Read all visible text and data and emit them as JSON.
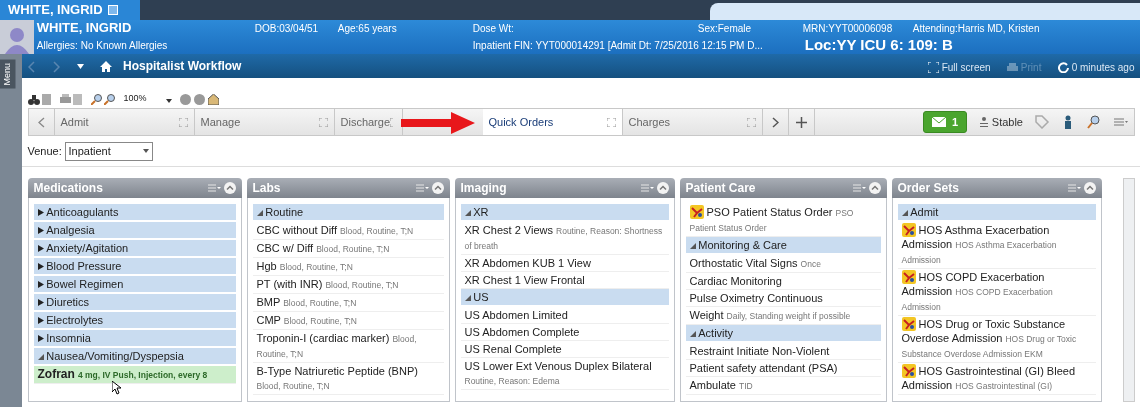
{
  "patient_tab": {
    "label": "WHITE, INGRID"
  },
  "banner": {
    "name": "WHITE, INGRID",
    "allergies": "Allergies: No Known Allergies",
    "row1": [
      "DOB:03/04/51",
      "Age:65 years",
      "Dose Wt:",
      "Sex:Female",
      "MRN:YYT00006098",
      "Attending:Harris MD, Kristen"
    ],
    "fin": "Inpatient FIN: YYT000014291 [Admit Dt: 7/25/2016 12:15 PM D...",
    "location": "Loc:YY ICU 6: 109: B"
  },
  "side_menu": {
    "label": "Menu"
  },
  "nav": {
    "title": "Hospitalist Workflow",
    "full_screen": "Full screen",
    "print": "Print",
    "refresh": "0 minutes ago"
  },
  "toolbar": {
    "zoom": "100%"
  },
  "tabs": [
    {
      "label": "Admit",
      "selected": false
    },
    {
      "label": "Manage",
      "selected": false
    },
    {
      "label": "Discharge",
      "selected": false
    },
    {
      "label": "Quick Orders",
      "selected": true
    },
    {
      "label": "Charges",
      "selected": false
    }
  ],
  "messages": {
    "count": "1"
  },
  "status": {
    "label": "Stable"
  },
  "venue": {
    "label": "Venue:",
    "value": "Inpatient"
  },
  "panels": [
    {
      "title": "Medications",
      "items": [
        {
          "kind": "group",
          "label": "Anticoagulants",
          "expanded": false
        },
        {
          "kind": "group",
          "label": "Analgesia",
          "expanded": false
        },
        {
          "kind": "group",
          "label": "Anxiety/Agitation",
          "expanded": false
        },
        {
          "kind": "group",
          "label": "Blood Pressure",
          "expanded": false
        },
        {
          "kind": "group",
          "label": "Bowel Regimen",
          "expanded": false
        },
        {
          "kind": "group",
          "label": "Diuretics",
          "expanded": false
        },
        {
          "kind": "group",
          "label": "Electrolytes",
          "expanded": false
        },
        {
          "kind": "group",
          "label": "Insomnia",
          "expanded": false
        },
        {
          "kind": "group",
          "label": "Nausea/Vomiting/Dyspepsia",
          "expanded": true
        },
        {
          "kind": "order",
          "label": "Zofran",
          "detail": "4 mg, IV Push, Injection, every 8",
          "selected": true
        }
      ]
    },
    {
      "title": "Labs",
      "items": [
        {
          "kind": "group",
          "label": "Routine",
          "expanded": true
        },
        {
          "kind": "order",
          "label": "CBC without Diff",
          "detail": "Blood, Routine, T;N",
          "selected": false
        },
        {
          "kind": "order",
          "label": "CBC w/ Diff",
          "detail": "Blood, Routine, T;N",
          "selected": false
        },
        {
          "kind": "order",
          "label": "Hgb",
          "detail": "Blood, Routine, T;N",
          "selected": false
        },
        {
          "kind": "order",
          "label": "PT (with INR)",
          "detail": "Blood, Routine, T;N",
          "selected": false
        },
        {
          "kind": "order",
          "label": "BMP",
          "detail": "Blood, Routine, T;N",
          "selected": false
        },
        {
          "kind": "order",
          "label": "CMP",
          "detail": "Blood, Routine, T;N",
          "selected": false
        },
        {
          "kind": "order",
          "label": "Troponin-I (cardiac marker)",
          "detail": "Blood, Routine, T;N",
          "selected": false
        },
        {
          "kind": "order",
          "label": "B-Type Natriuretic Peptide (BNP)",
          "detail": "Blood, Routine, T;N",
          "selected": false
        }
      ]
    },
    {
      "title": "Imaging",
      "items": [
        {
          "kind": "group",
          "label": "XR",
          "expanded": true
        },
        {
          "kind": "order",
          "label": "XR Chest 2 Views",
          "detail": "Routine, Reason: Shortness of breath",
          "selected": false
        },
        {
          "kind": "order",
          "label": "XR Abdomen KUB 1 View",
          "selected": false
        },
        {
          "kind": "order",
          "label": "XR Chest 1 View Frontal",
          "selected": false
        },
        {
          "kind": "group",
          "label": "US",
          "expanded": true
        },
        {
          "kind": "order",
          "label": "US Abdomen Limited",
          "selected": false
        },
        {
          "kind": "order",
          "label": "US Abdomen Complete",
          "selected": false
        },
        {
          "kind": "order",
          "label": "US Renal Complete",
          "selected": false
        },
        {
          "kind": "order",
          "label": "US Lower Ext Venous Duplex Bilateral",
          "detail": "Routine, Reason: Edema",
          "selected": false
        }
      ]
    },
    {
      "title": "Patient Care",
      "items": [
        {
          "kind": "order_set",
          "label": "PSO Patient Status Order",
          "detail": "PSO Patient Status Order",
          "selected": false
        },
        {
          "kind": "group",
          "label": "Monitoring & Care",
          "expanded": true
        },
        {
          "kind": "order",
          "label": "Orthostatic Vital Signs",
          "detail": "Once",
          "selected": false
        },
        {
          "kind": "order",
          "label": "Cardiac Monitoring",
          "selected": false
        },
        {
          "kind": "order",
          "label": "Pulse Oximetry Continuous",
          "selected": false
        },
        {
          "kind": "order",
          "label": "Weight",
          "detail": "Daily, Standing weight if possible",
          "selected": false
        },
        {
          "kind": "group",
          "label": "Activity",
          "expanded": true
        },
        {
          "kind": "order",
          "label": "Restraint Initiate Non-Violent",
          "selected": false
        },
        {
          "kind": "order",
          "label": "Patient safety attendant (PSA)",
          "selected": false
        },
        {
          "kind": "order",
          "label": "Ambulate",
          "detail": "TID",
          "selected": false
        }
      ]
    },
    {
      "title": "Order Sets",
      "items": [
        {
          "kind": "group",
          "label": "Admit",
          "expanded": true
        },
        {
          "kind": "order_set",
          "label": "HOS Asthma Exacerbation Admission",
          "detail": "HOS Asthma Exacerbation Admission",
          "selected": false
        },
        {
          "kind": "order_set",
          "label": "HOS COPD Exacerbation Admission",
          "detail": "HOS COPD Exacerbation Admission",
          "selected": false
        },
        {
          "kind": "order_set",
          "label": "HOS Drug or Toxic Substance Overdose Admission",
          "detail": "HOS Drug or Toxic Substance Overdose Admission EKM",
          "selected": false
        },
        {
          "kind": "order_set",
          "label": "HOS Gastrointestinal (GI) Bleed Admission",
          "detail": "HOS Gastrointestinal (GI)",
          "selected": false
        }
      ]
    }
  ]
}
